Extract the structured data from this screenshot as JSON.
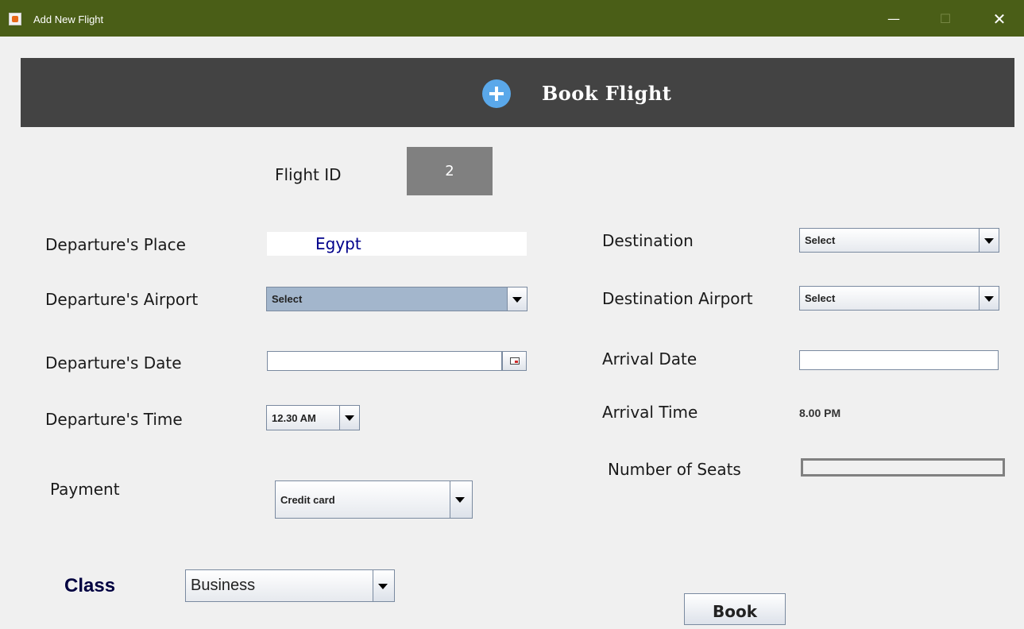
{
  "window": {
    "title": "Add New Flight",
    "minimize_symbol": "—",
    "maximize_symbol": "☐",
    "close_symbol": "✕"
  },
  "header": {
    "title": "Book Flight",
    "icon": "plus-circle-icon"
  },
  "flight_id": {
    "label": "Flight ID",
    "value": "2"
  },
  "departure_place": {
    "label": "Departure's Place",
    "value": "Egypt"
  },
  "departure_airport": {
    "label": "Departure's Airport",
    "value": "Select"
  },
  "departure_date": {
    "label": "Departure's Date",
    "value": ""
  },
  "departure_time": {
    "label": "Departure's Time",
    "value": "12.30 AM"
  },
  "payment": {
    "label": "Payment",
    "value": "Credit card"
  },
  "class": {
    "label": "Class",
    "value": "Business"
  },
  "destination": {
    "label": "Destination",
    "value": "Select"
  },
  "destination_airport": {
    "label": "Destination Airport",
    "value": "Select"
  },
  "arrival_date": {
    "label": "Arrival Date",
    "value": ""
  },
  "arrival_time": {
    "label": "Arrival Time",
    "value": "8.00 PM"
  },
  "seats": {
    "label": "Number of Seats",
    "value": ""
  },
  "book_button": {
    "label": "Book"
  },
  "colors": {
    "title_bar": "#4a5e17",
    "header_bar": "#434343",
    "plus_icon": "#5aa8ea",
    "id_box": "#808080",
    "selected_combo": "#a3b6cc",
    "place_text": "#00008b",
    "class_label": "#000040"
  }
}
